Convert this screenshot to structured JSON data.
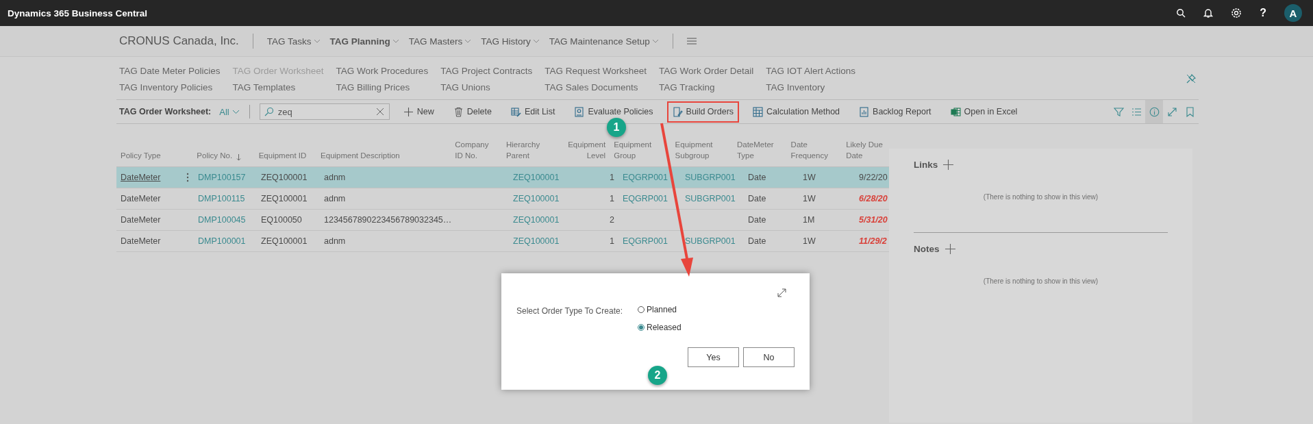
{
  "top_bar": {
    "title": "Dynamics 365 Business Central",
    "help": "?",
    "avatar": "A"
  },
  "nav": {
    "company": "CRONUS Canada, Inc.",
    "menus": [
      {
        "label": "TAG Tasks",
        "selected": false
      },
      {
        "label": "TAG Planning",
        "selected": true
      },
      {
        "label": "TAG Masters",
        "selected": false
      },
      {
        "label": "TAG History",
        "selected": false
      },
      {
        "label": "TAG Maintenance Setup",
        "selected": false
      }
    ]
  },
  "sub_links": [
    {
      "label": "TAG Date Meter Policies",
      "current": false
    },
    {
      "label": "TAG Inventory Policies",
      "current": false
    },
    {
      "label": "TAG Order Worksheet",
      "current": true
    },
    {
      "label": "TAG Templates",
      "current": false
    },
    {
      "label": "TAG Work Procedures",
      "current": false
    },
    {
      "label": "TAG Billing Prices",
      "current": false
    },
    {
      "label": "TAG Project Contracts",
      "current": false
    },
    {
      "label": "TAG Unions",
      "current": false
    },
    {
      "label": "TAG Request Worksheet",
      "current": false
    },
    {
      "label": "TAG Sales Documents",
      "current": false
    },
    {
      "label": "TAG Work Order Detail",
      "current": false
    },
    {
      "label": "TAG Tracking",
      "current": false
    },
    {
      "label": "TAG IOT Alert Actions",
      "current": false
    },
    {
      "label": "TAG Inventory",
      "current": false
    }
  ],
  "toolbar": {
    "title": "TAG Order Worksheet:",
    "view": "All",
    "search": {
      "value": "zeq"
    },
    "actions": [
      {
        "label": "New",
        "kind": "new",
        "highlighted": false
      },
      {
        "label": "Delete",
        "kind": "delete",
        "highlighted": false
      },
      {
        "label": "Edit List",
        "kind": "edit",
        "highlighted": false
      },
      {
        "label": "Evaluate Policies",
        "kind": "evaluate",
        "highlighted": false
      },
      {
        "label": "Build Orders",
        "kind": "build",
        "highlighted": true
      },
      {
        "label": "Calculation Method",
        "kind": "calc",
        "highlighted": false
      },
      {
        "label": "Backlog Report",
        "kind": "report",
        "highlighted": false
      },
      {
        "label": "Open in Excel",
        "kind": "excel",
        "highlighted": false
      }
    ],
    "view_buttons": [
      {
        "kind": "filter",
        "selected": false
      },
      {
        "kind": "list",
        "selected": false
      },
      {
        "kind": "info",
        "selected": true
      },
      {
        "kind": "expand",
        "selected": false
      },
      {
        "kind": "bookmark",
        "selected": false
      }
    ]
  },
  "table": {
    "columns": [
      {
        "label": "Policy Type",
        "kind": "text",
        "sorted": false
      },
      {
        "label": "Policy No.",
        "kind": "text",
        "sorted": true
      },
      {
        "label": "Equipment ID",
        "kind": "text",
        "sorted": false
      },
      {
        "label": "Equipment Description",
        "kind": "text",
        "sorted": false
      },
      {
        "label": "Company ID No.",
        "kind": "text",
        "sorted": false
      },
      {
        "label": "Hierarchy Parent",
        "kind": "text",
        "sorted": false
      },
      {
        "label": "Equipment Level",
        "kind": "number",
        "sorted": false
      },
      {
        "label": "Equipment Group",
        "kind": "text",
        "sorted": false
      },
      {
        "label": "Equipment Subgroup",
        "kind": "text",
        "sorted": false
      },
      {
        "label": "DateMeter Type",
        "kind": "text",
        "sorted": false
      },
      {
        "label": "Date Frequency",
        "kind": "text",
        "sorted": false
      },
      {
        "label": "Likely Due Date",
        "kind": "text",
        "sorted": false
      }
    ],
    "rows": [
      {
        "selected": true,
        "overdue": false,
        "cells": [
          "DateMeter",
          "DMP100157",
          "ZEQ100001",
          "adnm",
          "",
          "ZEQ100001",
          "1",
          "EQGRP001",
          "SUBGRP001",
          "Date",
          "1W",
          "9/22/20"
        ]
      },
      {
        "selected": false,
        "overdue": true,
        "cells": [
          "DateMeter",
          "DMP100115",
          "ZEQ100001",
          "adnm",
          "",
          "ZEQ100001",
          "1",
          "EQGRP001",
          "SUBGRP001",
          "Date",
          "1W",
          "6/28/20"
        ]
      },
      {
        "selected": false,
        "overdue": true,
        "cells": [
          "DateMeter",
          "DMP100045",
          "EQ100050",
          "1234567890223456789032345…",
          "",
          "ZEQ100001",
          "2",
          "",
          "",
          "Date",
          "1M",
          "5/31/20"
        ]
      },
      {
        "selected": false,
        "overdue": true,
        "cells": [
          "DateMeter",
          "DMP100001",
          "ZEQ100001",
          "adnm",
          "",
          "ZEQ100001",
          "1",
          "EQGRP001",
          "SUBGRP001",
          "Date",
          "1W",
          "11/29/2"
        ]
      }
    ]
  },
  "factbox": [
    {
      "title": "Links",
      "message": "(There is nothing to show in this view)"
    },
    {
      "title": "Notes",
      "message": "(There is nothing to show in this view)"
    }
  ],
  "dialog": {
    "label": "Select Order Type To Create:",
    "options": [
      {
        "label": "Planned",
        "selected": false
      },
      {
        "label": "Released",
        "selected": true
      }
    ],
    "buttons": [
      "Yes",
      "No"
    ]
  },
  "annotations": [
    "1",
    "2"
  ]
}
